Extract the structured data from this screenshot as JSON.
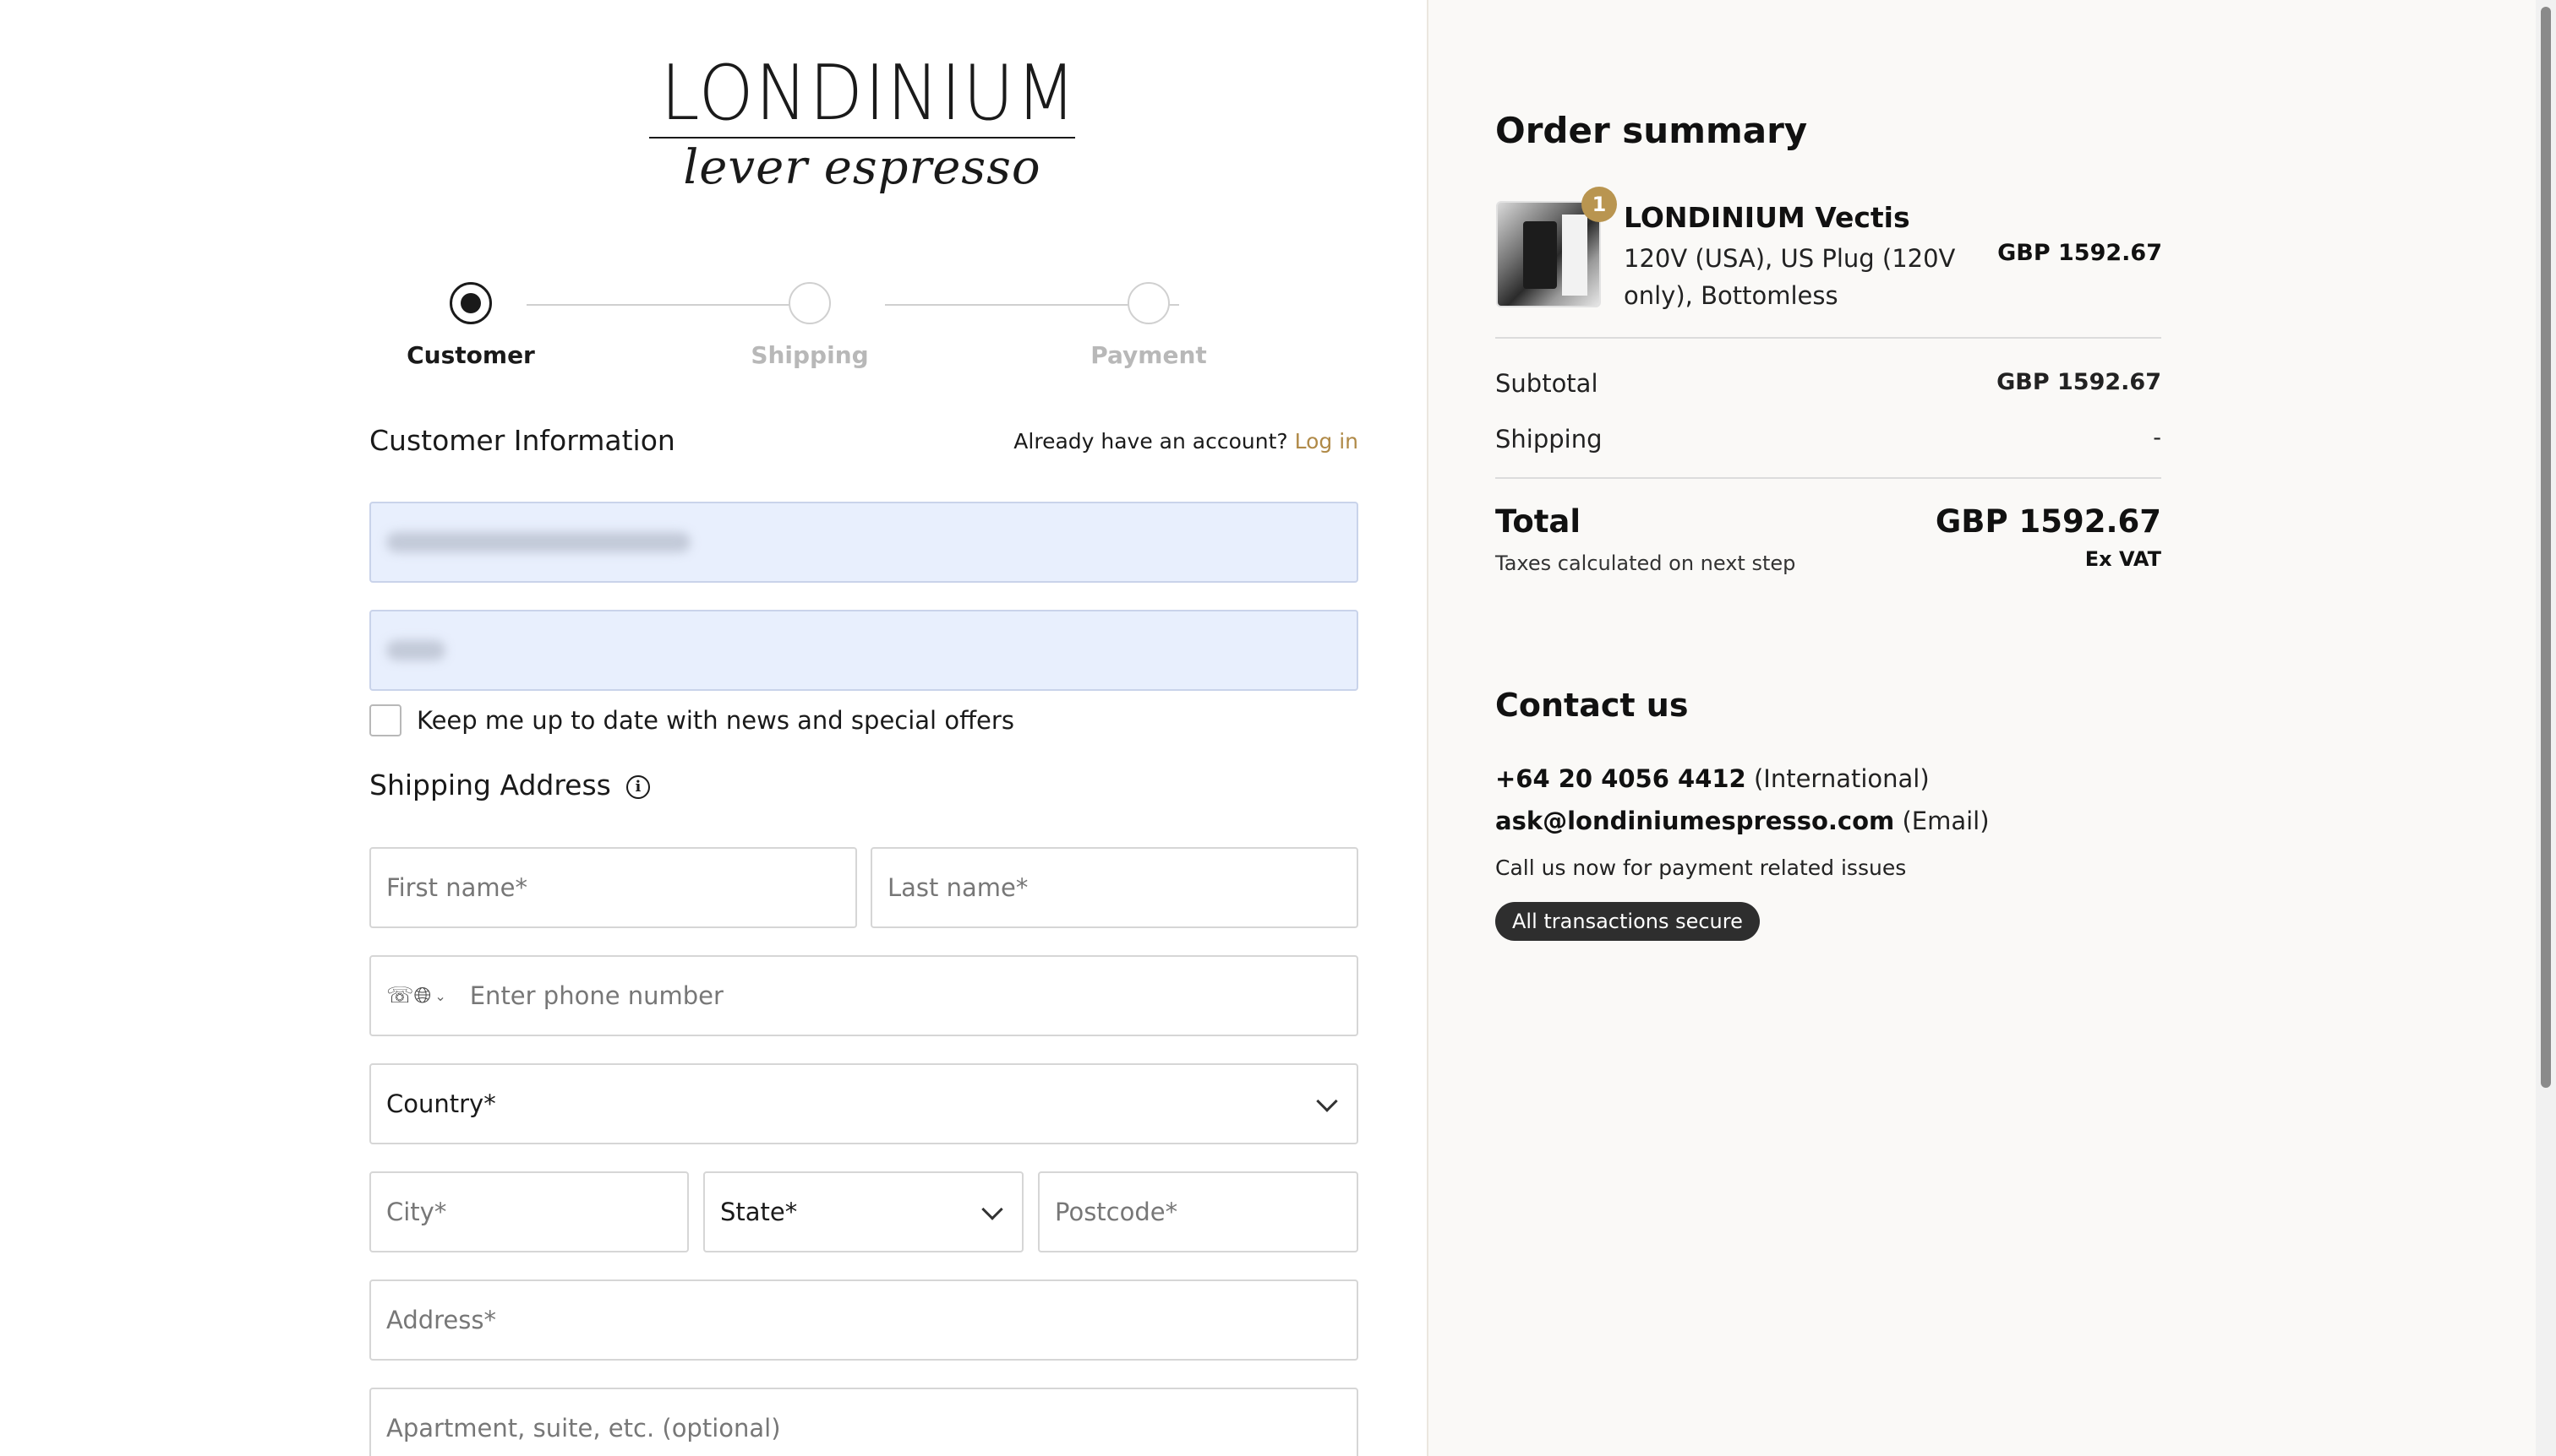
{
  "brand": {
    "name": "LONDINIUM",
    "tagline": "lever espresso"
  },
  "stepper": {
    "steps": [
      {
        "label": "Customer",
        "state": "active"
      },
      {
        "label": "Shipping",
        "state": "inactive"
      },
      {
        "label": "Payment",
        "state": "inactive"
      }
    ]
  },
  "customer": {
    "title": "Customer Information",
    "account_prompt": "Already have an account?",
    "login_label": "Log in",
    "newsletter_label": "Keep me up to date with news and special offers",
    "newsletter_checked": false
  },
  "shipping": {
    "title": "Shipping Address",
    "first_name_placeholder": "First name*",
    "last_name_placeholder": "Last name*",
    "phone_placeholder": "Enter phone number",
    "country_label": "Country*",
    "city_placeholder": "City*",
    "state_label": "State*",
    "postcode_placeholder": "Postcode*",
    "address_placeholder": "Address*",
    "apartment_placeholder": "Apartment, suite, etc. (optional)"
  },
  "order": {
    "title": "Order summary",
    "item": {
      "quantity": "1",
      "name": "LONDINIUM Vectis",
      "variant": "120V (USA), US Plug (120V only), Bottomless",
      "price": "GBP 1592.67"
    },
    "subtotal_label": "Subtotal",
    "subtotal_value": "GBP 1592.67",
    "shipping_label": "Shipping",
    "shipping_value": "-",
    "total_label": "Total",
    "total_value": "GBP 1592.67",
    "tax_note": "Taxes calculated on next step",
    "vat_note": "Ex VAT"
  },
  "contact": {
    "title": "Contact us",
    "phone": "+64 20 4056 4412",
    "phone_note": "(International)",
    "email": "ask@londiniumespresso.com",
    "email_note": "(Email)",
    "call_note": "Call us now for payment related issues",
    "secure_badge": "All transactions secure"
  },
  "colors": {
    "accent": "#b08a48",
    "badge": "#b99550",
    "autofill": "#e8effd",
    "panel": "#faf9f7"
  }
}
